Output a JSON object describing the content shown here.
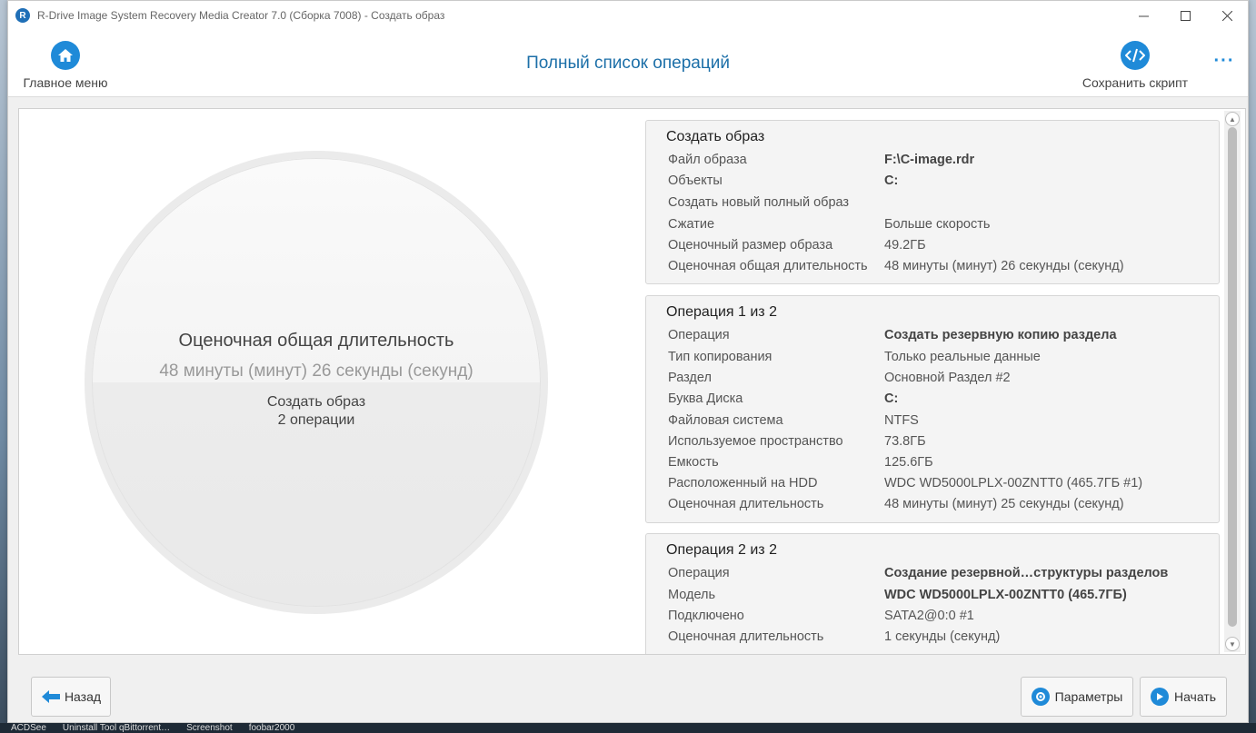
{
  "window": {
    "title": "R-Drive Image System Recovery Media Creator 7.0 (Сборка 7008) - Создать образ",
    "logo_letter": "R"
  },
  "header": {
    "home_label": "Главное меню",
    "page_title": "Полный список операций",
    "save_script_label": "Сохранить скрипт",
    "more_label": "···"
  },
  "summary": {
    "label": "Оценочная общая длительность",
    "duration": "48 минуты (минут) 26 секунды (секунд)",
    "operation": "Создать образ",
    "count": "2 операции"
  },
  "cards": [
    {
      "title": "Создать образ",
      "rows": [
        {
          "label": "Файл образа",
          "value": "F:\\C-image.rdr",
          "bold": true
        },
        {
          "label": "Объекты",
          "value": "C:",
          "bold": true
        },
        {
          "label": "Создать новый полный образ",
          "value": "",
          "bold": false
        },
        {
          "label": "Сжатие",
          "value": "Больше скорость",
          "bold": false
        },
        {
          "label": "Оценочный размер образа",
          "value": "49.2ГБ",
          "bold": false
        },
        {
          "label": "Оценочная общая длительность",
          "value": "48 минуты (минут) 26 секунды (секунд)",
          "bold": false
        }
      ]
    },
    {
      "title": "Операция 1 из 2",
      "rows": [
        {
          "label": "Операция",
          "value": "Создать резервную копию раздела",
          "bold": true
        },
        {
          "label": "Тип копирования",
          "value": "Только реальные данные",
          "bold": false
        },
        {
          "label": "Раздел",
          "value": "Основной Раздел #2",
          "bold": false
        },
        {
          "label": "Буква Диска",
          "value": "C:",
          "bold": true
        },
        {
          "label": "Файловая система",
          "value": "NTFS",
          "bold": false
        },
        {
          "label": "Используемое пространство",
          "value": "73.8ГБ",
          "bold": false
        },
        {
          "label": "Емкость",
          "value": "125.6ГБ",
          "bold": false
        },
        {
          "label": "Расположенный на HDD",
          "value": "WDC WD5000LPLX-00ZNTT0 (465.7ГБ #1)",
          "bold": false
        },
        {
          "label": "Оценочная длительность",
          "value": "48 минуты (минут) 25 секунды (секунд)",
          "bold": false
        }
      ]
    },
    {
      "title": "Операция 2 из 2",
      "rows": [
        {
          "label": "Операция",
          "value": "Создание резервной…структуры разделов",
          "bold": true
        },
        {
          "label": "Модель",
          "value": "WDC WD5000LPLX-00ZNTT0 (465.7ГБ)",
          "bold": true
        },
        {
          "label": "Подключено",
          "value": "SATA2@0:0 #1",
          "bold": false
        },
        {
          "label": "Оценочная длительность",
          "value": "1 секунды (секунд)",
          "bold": false
        }
      ]
    }
  ],
  "footer": {
    "back_label": "Назад",
    "params_label": "Параметры",
    "start_label": "Начать"
  },
  "taskbar": {
    "items": [
      "ACDSee",
      "Uninstall Tool  qBittorrent…",
      "Screenshot",
      "foobar2000"
    ]
  }
}
